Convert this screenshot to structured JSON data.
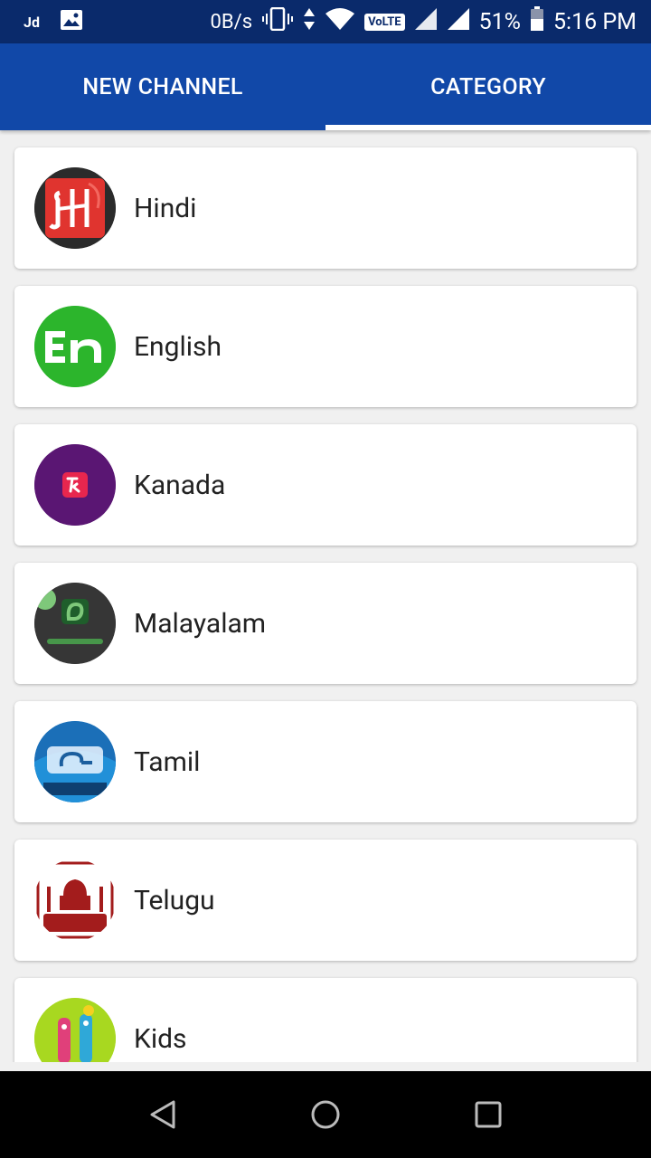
{
  "status_bar": {
    "carrier_badge": "Jd",
    "net_speed": "0B/s",
    "volte": "VoLTE",
    "battery": "51%",
    "time": "5:16 PM"
  },
  "tabs": [
    {
      "label": "NEW CHANNEL",
      "active": false
    },
    {
      "label": "CATEGORY",
      "active": true
    }
  ],
  "categories": [
    {
      "label": "Hindi",
      "icon": "hindi-logo-icon"
    },
    {
      "label": "English",
      "icon": "english-logo-icon"
    },
    {
      "label": "Kanada",
      "icon": "kanada-logo-icon"
    },
    {
      "label": "Malayalam",
      "icon": "malayalam-logo-icon"
    },
    {
      "label": "Tamil",
      "icon": "tamil-logo-icon"
    },
    {
      "label": "Telugu",
      "icon": "telugu-logo-icon"
    },
    {
      "label": "Kids",
      "icon": "kids-logo-icon"
    }
  ],
  "nav": {
    "back": "back-icon",
    "home": "home-icon",
    "recents": "recents-icon"
  }
}
